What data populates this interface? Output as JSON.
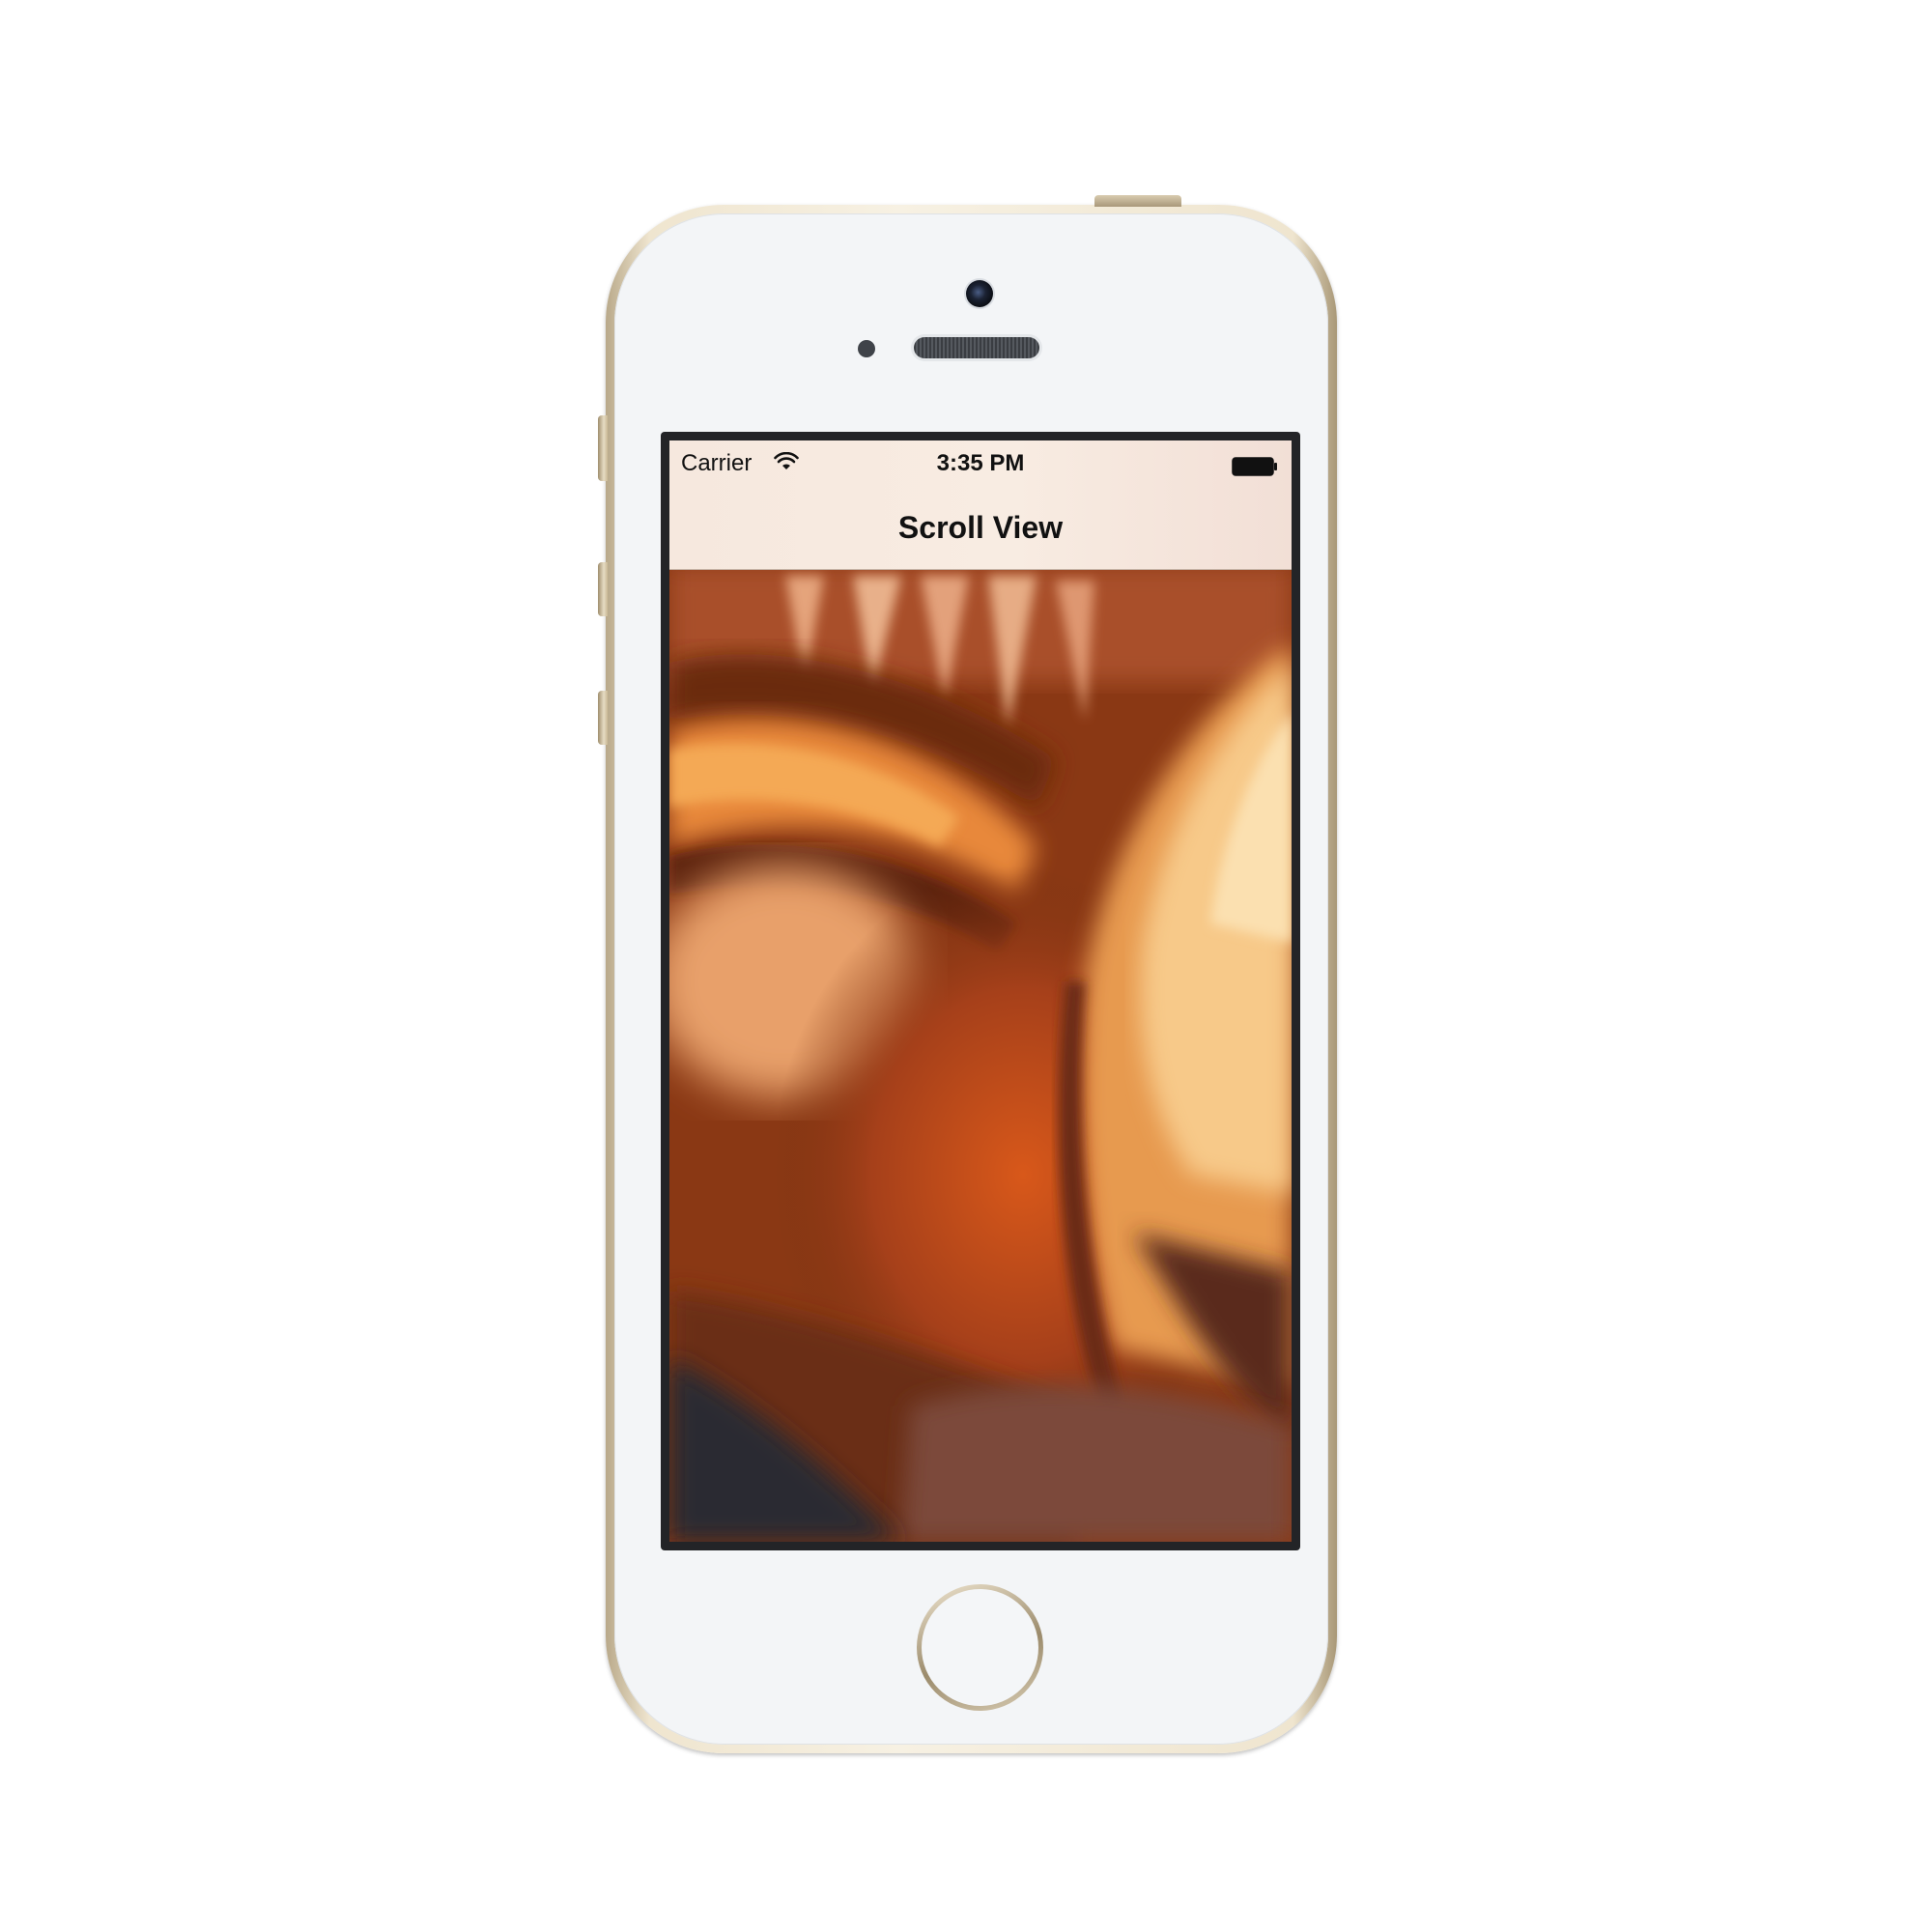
{
  "device": {
    "model": "iPhone 5s",
    "finish_color": "#e9dfc8"
  },
  "status_bar": {
    "carrier": "Carrier",
    "time": "3:35 PM",
    "wifi_icon": "wifi-icon",
    "battery_icon": "battery-full-icon"
  },
  "navigation_bar": {
    "title": "Scroll View",
    "tint_color": "#f6e8de"
  },
  "content": {
    "type": "scroll-view",
    "image": "zoomed-in-photo",
    "dominant_colors": [
      "#7a3212",
      "#c0541b",
      "#f3b76a",
      "#2a2b33"
    ]
  },
  "hardware": {
    "home_button_icon": "home-button",
    "camera_icon": "front-camera-icon",
    "speaker_icon": "earpiece-speaker-icon"
  }
}
